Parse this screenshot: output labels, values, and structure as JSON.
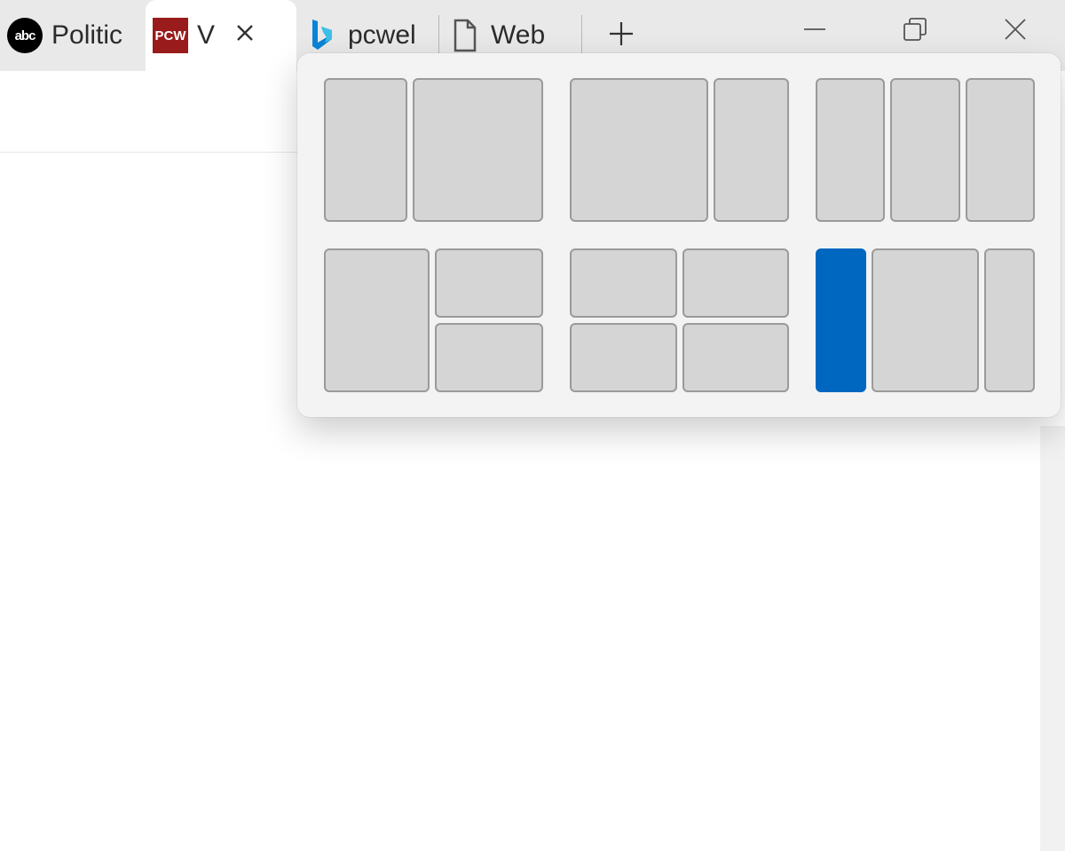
{
  "tabs": [
    {
      "title": "Politic",
      "favicon": "abc",
      "active": false
    },
    {
      "title": "V",
      "favicon": "pcw",
      "active": true
    },
    {
      "title": "pcwel",
      "favicon": "bing",
      "active": false
    },
    {
      "title": "Web",
      "favicon": "document",
      "active": false
    }
  ],
  "favicon_labels": {
    "abc": "abc",
    "pcw": "PCW"
  },
  "snap_layouts": [
    {
      "id": "two-col-small-large",
      "panes": [
        "small",
        "large"
      ],
      "selected": -1
    },
    {
      "id": "two-col-large-small",
      "panes": [
        "large",
        "small"
      ],
      "selected": -1
    },
    {
      "id": "three-col-equal",
      "panes": [
        "eq",
        "eq",
        "eq"
      ],
      "selected": -1
    },
    {
      "id": "left-plus-stack",
      "panes": [
        "left",
        "stack2"
      ],
      "selected": -1
    },
    {
      "id": "four-grid",
      "panes": [
        "grid2x2"
      ],
      "selected": -1
    },
    {
      "id": "three-col-left-selected",
      "panes": [
        "eq",
        "eq",
        "eq"
      ],
      "selected": 0
    }
  ],
  "colors": {
    "tab_inactive_bg": "#e9e9e9",
    "tab_active_bg": "#ffffff",
    "snap_bg": "#f3f3f3",
    "pane_fill": "#d5d5d5",
    "pane_border": "#9a9a9a",
    "pane_selected": "#0067c0"
  }
}
